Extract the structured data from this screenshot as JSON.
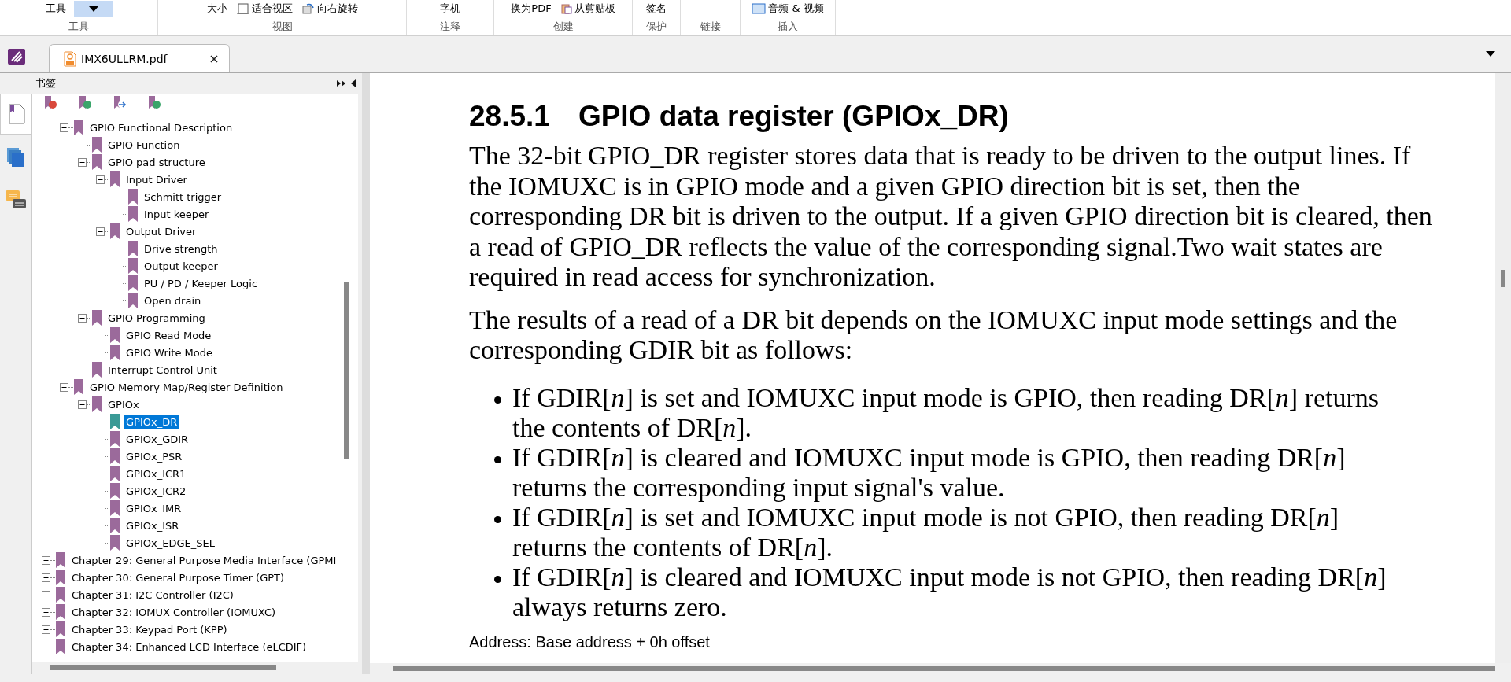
{
  "ribbon": {
    "groups": [
      {
        "label": "工具",
        "items": [
          {
            "kind": "text",
            "label": "工具"
          },
          {
            "kind": "dropdown"
          }
        ]
      },
      {
        "label": "视图",
        "items": [
          {
            "kind": "text",
            "label": "大小"
          },
          {
            "kind": "fit",
            "label": "适合视区"
          },
          {
            "kind": "rotate",
            "label": "向右旋转"
          }
        ]
      },
      {
        "label": "注释",
        "items": [
          {
            "kind": "text",
            "label": "字机"
          }
        ]
      },
      {
        "label": "创建",
        "items": [
          {
            "kind": "text",
            "label": "换为PDF"
          },
          {
            "kind": "clipboard",
            "label": "从剪贴板"
          }
        ]
      },
      {
        "label": "保护",
        "items": [
          {
            "kind": "text",
            "label": "签名"
          }
        ]
      },
      {
        "label": "链接"
      },
      {
        "label": "插入",
        "items": [
          {
            "kind": "media",
            "label": "音频 & 视频"
          }
        ]
      }
    ]
  },
  "tabs": [
    {
      "title": "IMX6ULLRM.pdf",
      "selected": true
    }
  ],
  "side_panels": [
    {
      "kind": "bookmarks",
      "selected": true
    },
    {
      "kind": "pages",
      "selected": false
    },
    {
      "kind": "comments",
      "selected": false
    }
  ],
  "bookmarks": {
    "title": "书签",
    "tree": [
      {
        "children": [
          {
            "label": "GPIO Functional Description",
            "expanded": true,
            "selected": false,
            "children": [
              {
                "label": "GPIO Function",
                "selected": false
              },
              {
                "label": "GPIO pad structure",
                "expanded": true,
                "selected": false,
                "children": [
                  {
                    "label": "Input Driver",
                    "expanded": true,
                    "selected": false,
                    "children": [
                      {
                        "label": "Schmitt trigger",
                        "selected": false
                      },
                      {
                        "label": "Input keeper",
                        "selected": false
                      }
                    ]
                  },
                  {
                    "label": "Output Driver",
                    "expanded": true,
                    "selected": false,
                    "children": [
                      {
                        "label": "Drive strength",
                        "selected": false
                      },
                      {
                        "label": "Output keeper",
                        "selected": false
                      },
                      {
                        "label": "PU / PD / Keeper Logic",
                        "selected": false
                      },
                      {
                        "label": "Open drain",
                        "selected": false
                      }
                    ]
                  }
                ]
              },
              {
                "label": "GPIO Programming",
                "expanded": true,
                "selected": false,
                "children": [
                  {
                    "label": "GPIO Read Mode",
                    "selected": false
                  },
                  {
                    "label": "GPIO Write Mode",
                    "selected": false
                  }
                ]
              },
              {
                "label": "Interrupt Control Unit",
                "selected": false
              }
            ]
          },
          {
            "label": "GPIO Memory Map/Register Definition",
            "expanded": true,
            "selected": false,
            "children": [
              {
                "label": "GPIOx",
                "expanded": true,
                "selected": false,
                "children": [
                  {
                    "label": "GPIOx_DR",
                    "selected": true
                  },
                  {
                    "label": "GPIOx_GDIR",
                    "selected": false
                  },
                  {
                    "label": "GPIOx_PSR",
                    "selected": false
                  },
                  {
                    "label": "GPIOx_ICR1",
                    "selected": false
                  },
                  {
                    "label": "GPIOx_ICR2",
                    "selected": false
                  },
                  {
                    "label": "GPIOx_IMR",
                    "selected": false
                  },
                  {
                    "label": "GPIOx_ISR",
                    "selected": false
                  },
                  {
                    "label": "GPIOx_EDGE_SEL",
                    "selected": false
                  }
                ]
              }
            ]
          }
        ]
      },
      {
        "label": "Chapter 29: General Purpose Media Interface (GPMI",
        "expanded": false,
        "selected": false
      },
      {
        "label": "Chapter 30: General Purpose Timer (GPT)",
        "expanded": false,
        "selected": false
      },
      {
        "label": "Chapter 31: I2C Controller (I2C)",
        "expanded": false,
        "selected": false
      },
      {
        "label": "Chapter 32: IOMUX Controller (IOMUXC)",
        "expanded": false,
        "selected": false
      },
      {
        "label": "Chapter 33: Keypad Port (KPP)",
        "expanded": false,
        "selected": false
      },
      {
        "label": "Chapter 34: Enhanced LCD Interface (eLCDIF)",
        "expanded": false,
        "selected": false
      }
    ]
  },
  "document": {
    "number": "28.5.1",
    "title": "GPIO data register (GPIOx_DR)",
    "paragraphs": [
      "The 32-bit GPIO_DR register stores data that is ready to be driven to the output lines. If the IOMUXC is in GPIO mode and a given GPIO direction bit is set, then the corresponding DR bit is driven to the output. If a given GPIO direction bit is cleared, then a read of GPIO_DR reflects the value of the corresponding signal.Two wait states are required in read access for synchronization.",
      "The results of a read of a DR bit depends on the IOMUXC input mode settings and the corresponding GDIR bit as follows:"
    ],
    "bullets": [
      "If GDIR[*n*] is set and IOMUXC input mode is GPIO, then reading DR[*n*] returns the contents of DR[*n*].",
      "If GDIR[*n*] is cleared and IOMUXC input mode is GPIO, then reading DR[*n*] returns the corresponding input signal's value.",
      "If GDIR[*n*] is set and IOMUXC input mode is not GPIO, then reading DR[*n*] returns the contents of DR[*n*].",
      "If GDIR[*n*] is cleared and IOMUXC input mode is not GPIO, then reading DR[*n*] always returns zero."
    ],
    "address": "Address: Base address + 0h offset"
  }
}
